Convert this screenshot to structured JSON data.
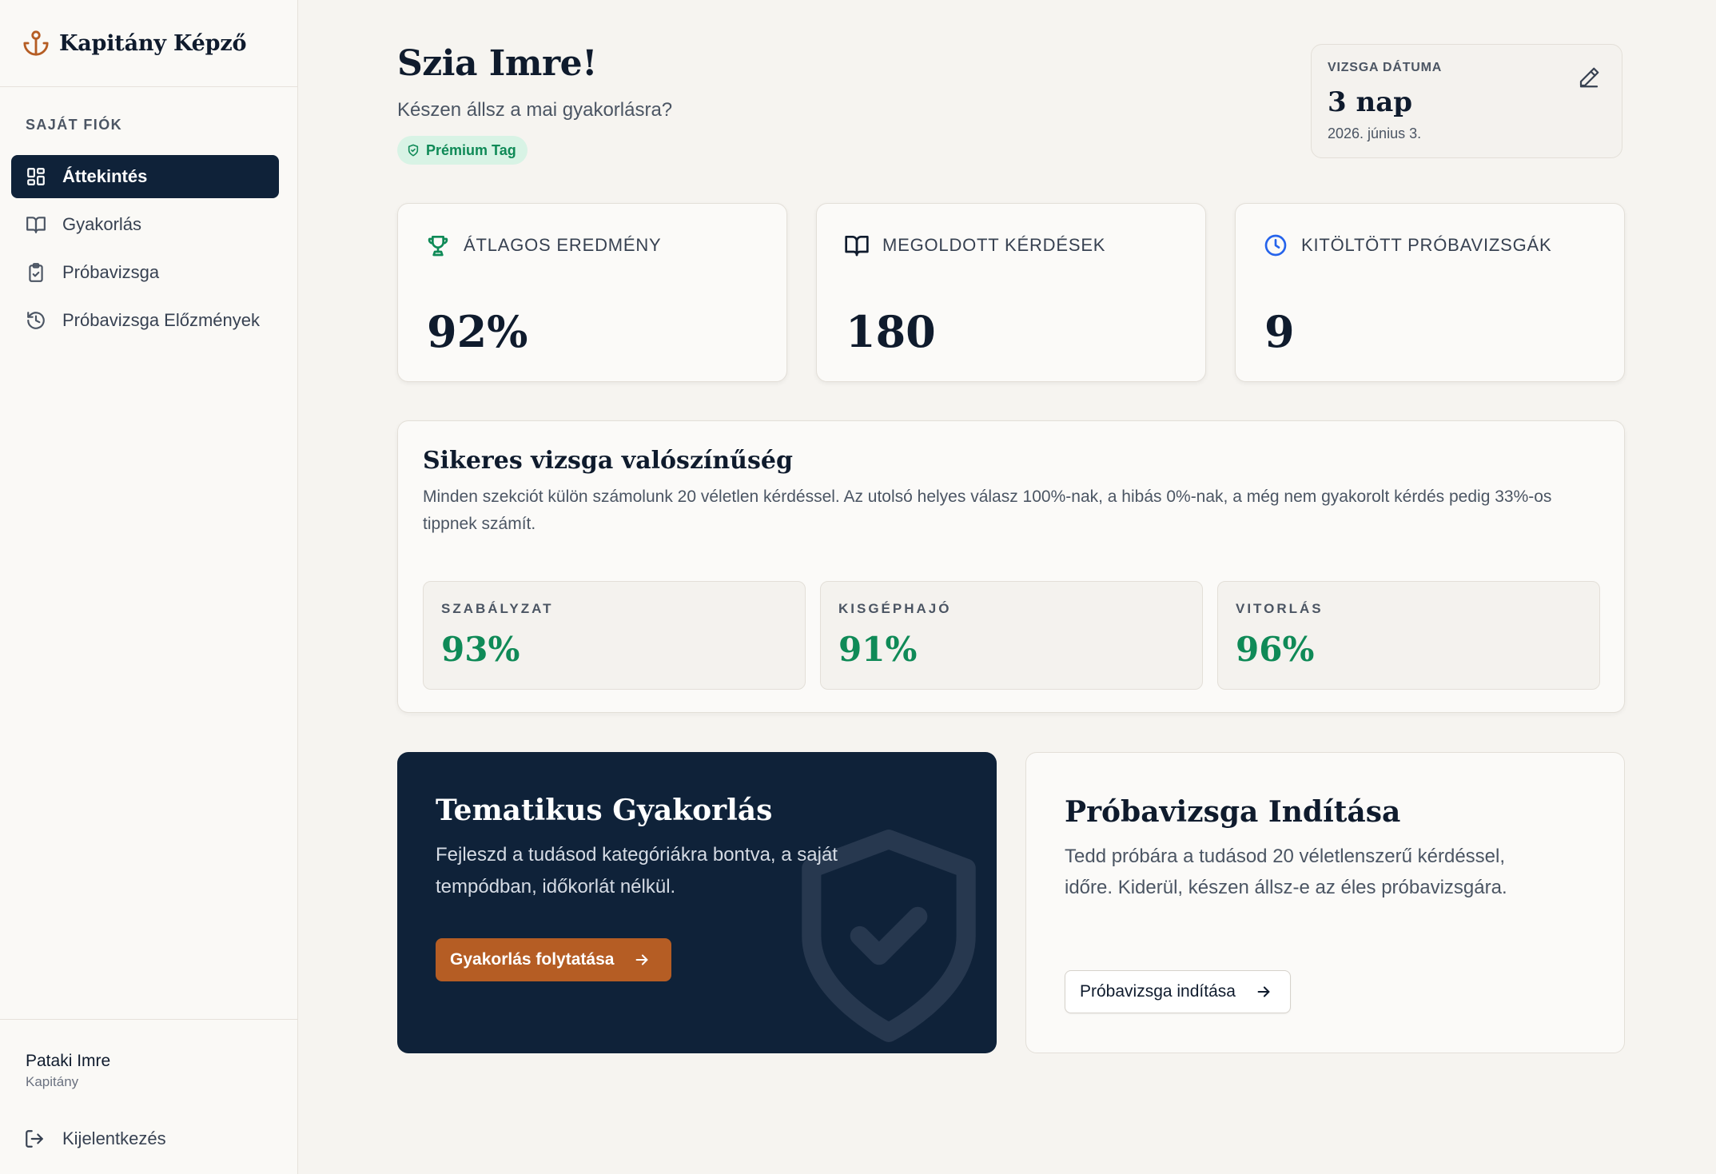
{
  "brand": {
    "name": "Kapitány Képző",
    "icon": "anchor-icon"
  },
  "sidebar": {
    "section_label": "SAJÁT FIÓK",
    "items": [
      {
        "label": "Áttekintés",
        "icon": "dashboard-grid-icon",
        "active": true
      },
      {
        "label": "Gyakorlás",
        "icon": "book-open-icon",
        "active": false
      },
      {
        "label": "Próbavizsga",
        "icon": "clipboard-check-icon",
        "active": false
      },
      {
        "label": "Próbavizsga Előzmények",
        "icon": "history-icon",
        "active": false
      }
    ],
    "user": {
      "name": "Pataki Imre",
      "role": "Kapitány"
    },
    "logout_label": "Kijelentkezés"
  },
  "header": {
    "greeting": "Szia Imre!",
    "subtitle": "Készen állsz a mai gyakorlásra?",
    "badge": "Prémium Tag"
  },
  "exam": {
    "label": "VIZSGA DÁTUMA",
    "value": "3 nap",
    "date": "2026. június 3."
  },
  "stats": [
    {
      "label": "ÁTLAGOS EREDMÉNY",
      "value": "92%",
      "icon": "trophy-icon"
    },
    {
      "label": "MEGOLDOTT KÉRDÉSEK",
      "value": "180",
      "icon": "book-open-icon"
    },
    {
      "label": "KITÖLTÖTT PRÓBAVIZSGÁK",
      "value": "9",
      "icon": "clock-icon"
    }
  ],
  "probability": {
    "title": "Sikeres vizsga valószínűség",
    "description": "Minden szekciót külön számolunk 20 véletlen kérdéssel. Az utolsó helyes válasz 100%-nak, a hibás 0%-nak, a még nem gyakorolt kérdés pedig 33%-os tippnek számít.",
    "sections": [
      {
        "label": "SZABÁLYZAT",
        "value": "93%"
      },
      {
        "label": "KISGÉPHAJÓ",
        "value": "91%"
      },
      {
        "label": "VITORLÁS",
        "value": "96%"
      }
    ]
  },
  "practice_card": {
    "title": "Tematikus Gyakorlás",
    "description": "Fejleszd a tudásod kategóriákra bontva, a saját tempódban, időkorlát nélkül.",
    "button": "Gyakorlás folytatása"
  },
  "mock_card": {
    "title": "Próbavizsga Indítása",
    "description": "Tedd próbára a tudásod 20 véletlenszerű kérdéssel, időre. Kiderül, készen állsz-e az éles próbavizsgára.",
    "button": "Próbavizsga indítása"
  },
  "colors": {
    "navy": "#0f2239",
    "accent_orange": "#b55d24",
    "success_green": "#0f8a57",
    "background": "#f6f4f0"
  }
}
